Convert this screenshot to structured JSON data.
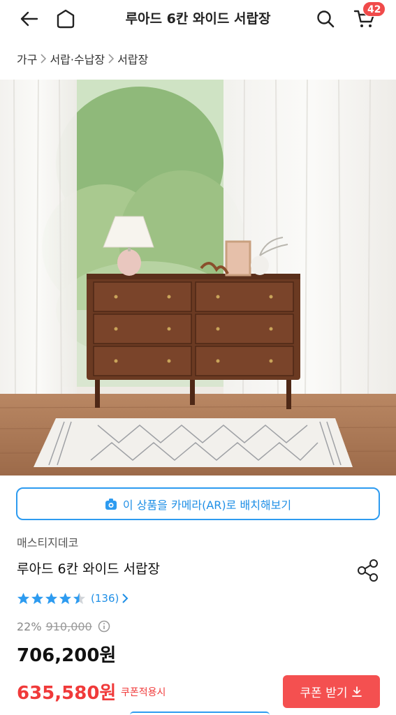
{
  "header": {
    "title": "루아드 6칸 와이드 서랍장",
    "cart_count": "42",
    "icons": [
      "back-arrow-icon",
      "home-icon",
      "search-icon",
      "cart-icon"
    ]
  },
  "breadcrumb": [
    "가구",
    "서랍·수납장",
    "서랍장"
  ],
  "ar_button": {
    "label": "이 상품을 카메라(AR)로 배치해보기",
    "icon": "camera-icon"
  },
  "product": {
    "brand": "매스티지데코",
    "name": "루아드 6칸 와이드 서랍장",
    "rating": 4.5,
    "review_count": "(136)",
    "discount_rate": "22%",
    "original_price": "910,000",
    "price": "706,200원",
    "coupon_price": "635,580원",
    "coupon_label": "쿠폰적용시",
    "coupon_button": "쿠폰 받기"
  },
  "colors": {
    "accent_blue": "#2d9bf0",
    "sale_red": "#f03a3a",
    "badge_red": "#f04a4a"
  }
}
